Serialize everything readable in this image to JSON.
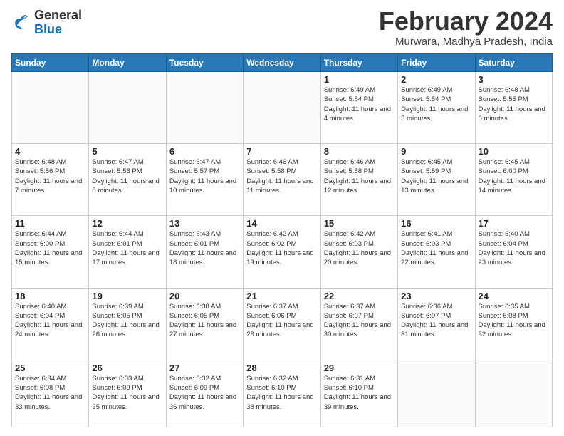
{
  "logo": {
    "general": "General",
    "blue": "Blue"
  },
  "header": {
    "title": "February 2024",
    "subtitle": "Murwara, Madhya Pradesh, India"
  },
  "weekdays": [
    "Sunday",
    "Monday",
    "Tuesday",
    "Wednesday",
    "Thursday",
    "Friday",
    "Saturday"
  ],
  "weeks": [
    [
      {
        "day": "",
        "info": ""
      },
      {
        "day": "",
        "info": ""
      },
      {
        "day": "",
        "info": ""
      },
      {
        "day": "",
        "info": ""
      },
      {
        "day": "1",
        "info": "Sunrise: 6:49 AM\nSunset: 5:54 PM\nDaylight: 11 hours and 4 minutes."
      },
      {
        "day": "2",
        "info": "Sunrise: 6:49 AM\nSunset: 5:54 PM\nDaylight: 11 hours and 5 minutes."
      },
      {
        "day": "3",
        "info": "Sunrise: 6:48 AM\nSunset: 5:55 PM\nDaylight: 11 hours and 6 minutes."
      }
    ],
    [
      {
        "day": "4",
        "info": "Sunrise: 6:48 AM\nSunset: 5:56 PM\nDaylight: 11 hours and 7 minutes."
      },
      {
        "day": "5",
        "info": "Sunrise: 6:47 AM\nSunset: 5:56 PM\nDaylight: 11 hours and 8 minutes."
      },
      {
        "day": "6",
        "info": "Sunrise: 6:47 AM\nSunset: 5:57 PM\nDaylight: 11 hours and 10 minutes."
      },
      {
        "day": "7",
        "info": "Sunrise: 6:46 AM\nSunset: 5:58 PM\nDaylight: 11 hours and 11 minutes."
      },
      {
        "day": "8",
        "info": "Sunrise: 6:46 AM\nSunset: 5:58 PM\nDaylight: 11 hours and 12 minutes."
      },
      {
        "day": "9",
        "info": "Sunrise: 6:45 AM\nSunset: 5:59 PM\nDaylight: 11 hours and 13 minutes."
      },
      {
        "day": "10",
        "info": "Sunrise: 6:45 AM\nSunset: 6:00 PM\nDaylight: 11 hours and 14 minutes."
      }
    ],
    [
      {
        "day": "11",
        "info": "Sunrise: 6:44 AM\nSunset: 6:00 PM\nDaylight: 11 hours and 15 minutes."
      },
      {
        "day": "12",
        "info": "Sunrise: 6:44 AM\nSunset: 6:01 PM\nDaylight: 11 hours and 17 minutes."
      },
      {
        "day": "13",
        "info": "Sunrise: 6:43 AM\nSunset: 6:01 PM\nDaylight: 11 hours and 18 minutes."
      },
      {
        "day": "14",
        "info": "Sunrise: 6:42 AM\nSunset: 6:02 PM\nDaylight: 11 hours and 19 minutes."
      },
      {
        "day": "15",
        "info": "Sunrise: 6:42 AM\nSunset: 6:03 PM\nDaylight: 11 hours and 20 minutes."
      },
      {
        "day": "16",
        "info": "Sunrise: 6:41 AM\nSunset: 6:03 PM\nDaylight: 11 hours and 22 minutes."
      },
      {
        "day": "17",
        "info": "Sunrise: 6:40 AM\nSunset: 6:04 PM\nDaylight: 11 hours and 23 minutes."
      }
    ],
    [
      {
        "day": "18",
        "info": "Sunrise: 6:40 AM\nSunset: 6:04 PM\nDaylight: 11 hours and 24 minutes."
      },
      {
        "day": "19",
        "info": "Sunrise: 6:39 AM\nSunset: 6:05 PM\nDaylight: 11 hours and 26 minutes."
      },
      {
        "day": "20",
        "info": "Sunrise: 6:38 AM\nSunset: 6:05 PM\nDaylight: 11 hours and 27 minutes."
      },
      {
        "day": "21",
        "info": "Sunrise: 6:37 AM\nSunset: 6:06 PM\nDaylight: 11 hours and 28 minutes."
      },
      {
        "day": "22",
        "info": "Sunrise: 6:37 AM\nSunset: 6:07 PM\nDaylight: 11 hours and 30 minutes."
      },
      {
        "day": "23",
        "info": "Sunrise: 6:36 AM\nSunset: 6:07 PM\nDaylight: 11 hours and 31 minutes."
      },
      {
        "day": "24",
        "info": "Sunrise: 6:35 AM\nSunset: 6:08 PM\nDaylight: 11 hours and 32 minutes."
      }
    ],
    [
      {
        "day": "25",
        "info": "Sunrise: 6:34 AM\nSunset: 6:08 PM\nDaylight: 11 hours and 33 minutes."
      },
      {
        "day": "26",
        "info": "Sunrise: 6:33 AM\nSunset: 6:09 PM\nDaylight: 11 hours and 35 minutes."
      },
      {
        "day": "27",
        "info": "Sunrise: 6:32 AM\nSunset: 6:09 PM\nDaylight: 11 hours and 36 minutes."
      },
      {
        "day": "28",
        "info": "Sunrise: 6:32 AM\nSunset: 6:10 PM\nDaylight: 11 hours and 38 minutes."
      },
      {
        "day": "29",
        "info": "Sunrise: 6:31 AM\nSunset: 6:10 PM\nDaylight: 11 hours and 39 minutes."
      },
      {
        "day": "",
        "info": ""
      },
      {
        "day": "",
        "info": ""
      }
    ]
  ]
}
